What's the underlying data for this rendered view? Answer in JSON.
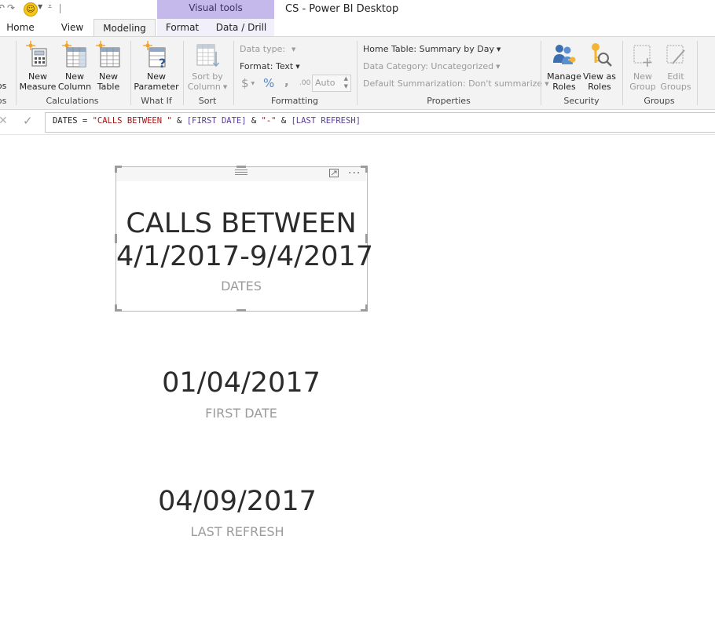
{
  "title_bar": {
    "contextual_group": "Visual tools",
    "app_title": "CS - Power BI Desktop"
  },
  "tabs": [
    "Home",
    "View",
    "Modeling",
    "Format",
    "Data / Drill"
  ],
  "active_tab": "Modeling",
  "ribbon": {
    "calculations": {
      "cut_label": "ps",
      "new_measure": [
        "New",
        "Measure"
      ],
      "new_column": [
        "New",
        "Column"
      ],
      "new_table": [
        "New",
        "Table"
      ],
      "group_label": "Calculations",
      "left_group_label": "ps"
    },
    "what_if": {
      "new_parameter": [
        "New",
        "Parameter"
      ],
      "group_label": "What If"
    },
    "sort": {
      "sort_by_column": [
        "Sort by",
        "Column"
      ],
      "group_label": "Sort"
    },
    "formatting": {
      "data_type_label": "Data type:",
      "format_label": "Format: Text",
      "currency_symbol": "$",
      "percent_symbol": "%",
      "comma_symbol": ",",
      "decimals_symbol": ".00",
      "auto_value": "Auto",
      "group_label": "Formatting"
    },
    "properties": {
      "home_table": "Home Table: Summary by Day",
      "data_category": "Data Category: Uncategorized",
      "default_summarization": "Default Summarization: Don't summarize",
      "group_label": "Properties"
    },
    "security": {
      "manage_roles": [
        "Manage",
        "Roles"
      ],
      "view_as_roles": [
        "View as",
        "Roles"
      ],
      "group_label": "Security"
    },
    "groups": {
      "new_group": [
        "New",
        "Group"
      ],
      "edit_groups": [
        "Edit",
        "Groups"
      ],
      "group_label": "Groups"
    }
  },
  "formula": {
    "name": "DATES",
    "op_eq": " = ",
    "str1": "\"CALLS BETWEEN \"",
    "amp1": " & ",
    "ref1": "[FIRST DATE]",
    "amp2": " & ",
    "str2": "\"-\"",
    "amp3": " & ",
    "ref2": "[LAST REFRESH]"
  },
  "cards": [
    {
      "value_line1": "CALLS BETWEEN",
      "value_line2": "4/1/2017-9/4/2017",
      "label": "DATES"
    },
    {
      "value": "01/04/2017",
      "label": "FIRST DATE"
    },
    {
      "value": "04/09/2017",
      "label": "LAST REFRESH"
    }
  ],
  "colors": {
    "visual_tools_accent": "#c5b8ea",
    "ribbon_bg": "#f3f3f3",
    "dax_string": "#a31515",
    "dax_reference": "#5a3d99",
    "card_value": "#2b2b2b",
    "card_label": "#9b9b9b"
  }
}
